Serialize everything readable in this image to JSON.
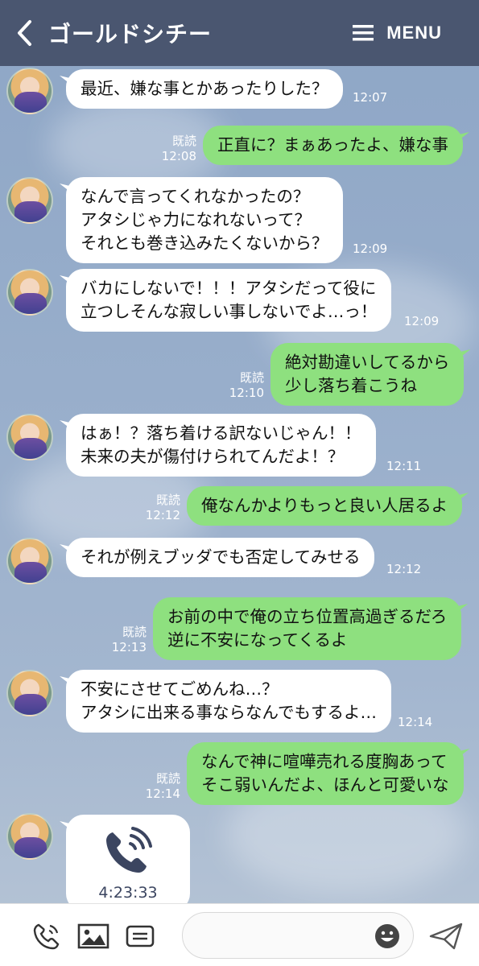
{
  "header": {
    "title": "ゴールドシチー",
    "menu_label": "MENU"
  },
  "messages": [
    {
      "lines": [
        "最近、嫌な事とかあったりした？"
      ],
      "time": "12:07"
    },
    {
      "lines": [
        "正直に？まぁあったよ、嫌な事"
      ],
      "read": "既読",
      "time": "12:08"
    },
    {
      "lines": [
        "なんで言ってくれなかったの？",
        "アタシじゃ力になれないって？",
        "それとも巻き込みたくないから？"
      ],
      "time": "12:09"
    },
    {
      "lines": [
        "バカにしないで！！！アタシだって役に",
        "立つしそんな寂しい事しないでよ…っ！"
      ],
      "time": "12:09"
    },
    {
      "lines": [
        "絶対勘違いしてるから",
        "少し落ち着こうね"
      ],
      "read": "既読",
      "time": "12:10"
    },
    {
      "lines": [
        "はぁ！？落ち着ける訳ないじゃん！！",
        "未来の夫が傷付けられてんだよ！？"
      ],
      "time": "12:11"
    },
    {
      "lines": [
        "俺なんかよりもっと良い人居るよ"
      ],
      "read": "既読",
      "time": "12:12"
    },
    {
      "lines": [
        "それが例えブッダでも否定してみせる"
      ],
      "time": "12:12"
    },
    {
      "lines": [
        "お前の中で俺の立ち位置高過ぎるだろ",
        "逆に不安になってくるよ"
      ],
      "read": "既読",
      "time": "12:13"
    },
    {
      "lines": [
        "不安にさせてごめんね…？",
        "アタシに出来る事ならなんでもするよ…"
      ],
      "time": "12:14"
    },
    {
      "lines": [
        "なんで神に喧嘩売れる度胸あって",
        "そこ弱いんだよ、ほんと可愛いな"
      ],
      "read": "既読",
      "time": "12:14"
    }
  ],
  "call": {
    "duration": "4:23:33",
    "icon": "phone-call-icon"
  },
  "icons": [
    "back-arrow-icon",
    "hamburger-menu-icon",
    "voice-call-icon",
    "image-icon",
    "keep-memo-icon",
    "emoji-icon",
    "send-icon"
  ],
  "colors": {
    "header": "#4a5670",
    "outgoing_bubble": "#8ee07f",
    "incoming_bubble": "#ffffff"
  }
}
